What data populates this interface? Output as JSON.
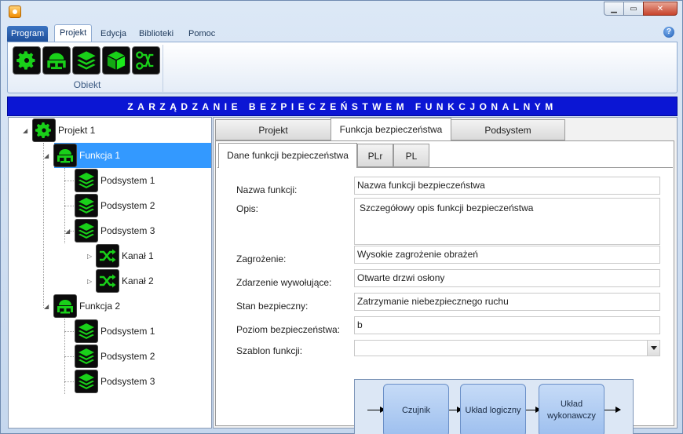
{
  "menu": {
    "program": "Program",
    "items": [
      "Projekt",
      "Edycja",
      "Biblioteki",
      "Pomoc"
    ]
  },
  "ribbon": {
    "group_label": "Obiekt",
    "buttons": [
      "gear-icon",
      "function-icon",
      "layers-icon",
      "cube-icon",
      "channel-icon"
    ]
  },
  "header": {
    "title": "ZARZĄDZANIE BEZPIECZEŃSTWEM FUNKCJONALNYM"
  },
  "tree": {
    "project": "Projekt 1",
    "function1": "Funkcja 1",
    "f1_sub1": "Podsystem 1",
    "f1_sub2": "Podsystem 2",
    "f1_sub3": "Podsystem 3",
    "channel1": "Kanał 1",
    "channel2": "Kanał 2",
    "function2": "Funkcja 2",
    "f2_sub1": "Podsystem 1",
    "f2_sub2": "Podsystem 2",
    "f2_sub3": "Podsystem 3"
  },
  "tabs": {
    "projekt": "Projekt",
    "funkcja": "Funkcja bezpieczeństwa",
    "podsystem": "Podsystem"
  },
  "subtabs": {
    "dane": "Dane funkcji bezpieczeństwa",
    "plr": "PLr",
    "pl": "PL"
  },
  "form": {
    "name_label": "Nazwa funkcji:",
    "name_value": "Nazwa funkcji bezpieczeństwa",
    "desc_label": "Opis:",
    "desc_value": "Szczegółowy opis funkcji bezpieczeństwa",
    "hazard_label": "Zagrożenie:",
    "hazard_value": "Wysokie zagrożenie obrażeń",
    "event_label": "Zdarzenie wywołujące:",
    "event_value": "Otwarte drzwi osłony",
    "safe_label": "Stan bezpieczny:",
    "safe_value": "Zatrzymanie niebezpiecznego ruchu",
    "level_label": "Poziom bezpieczeństwa:",
    "level_value": "b",
    "template_label": "Szablon funkcji:",
    "template_value": ""
  },
  "diagram": {
    "box1": "Czujnik",
    "box2": "Układ logiczny",
    "box3": "Układ wykonawczy"
  },
  "colors": {
    "header_bg": "#0b16d4",
    "selection": "#3399ff",
    "icon_green": "#19d019"
  }
}
